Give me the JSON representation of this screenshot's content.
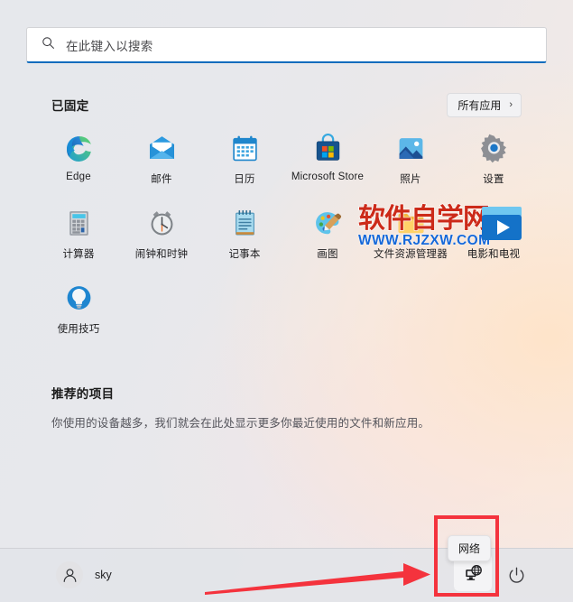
{
  "search": {
    "placeholder": "在此键入以搜索",
    "icon": "search-icon",
    "accent": "#0f6cbd"
  },
  "pinned": {
    "title": "已固定",
    "all_apps_label": "所有应用",
    "all_apps_chevron": "›",
    "rows": [
      [
        {
          "label": "Edge",
          "icon": "edge-icon"
        },
        {
          "label": "邮件",
          "icon": "mail-icon"
        },
        {
          "label": "日历",
          "icon": "calendar-icon"
        },
        {
          "label": "Microsoft Store",
          "icon": "microsoft-store-icon"
        },
        {
          "label": "照片",
          "icon": "photos-icon"
        },
        {
          "label": "设置",
          "icon": "settings-gear-icon"
        }
      ],
      [
        {
          "label": "计算器",
          "icon": "calculator-icon"
        },
        {
          "label": "闹钟和时钟",
          "icon": "alarm-clock-icon"
        },
        {
          "label": "记事本",
          "icon": "notepad-icon"
        },
        {
          "label": "画图",
          "icon": "paint-palette-icon"
        },
        {
          "label": "文件资源管理器",
          "icon": "file-explorer-icon"
        },
        {
          "label": "电影和电视",
          "icon": "movies-tv-icon"
        }
      ],
      [
        {
          "label": "使用技巧",
          "icon": "tips-lightbulb-icon"
        }
      ]
    ]
  },
  "recommended": {
    "title": "推荐的项目",
    "description": "你使用的设备越多，我们就会在此处显示更多你最近使用的文件和新应用。"
  },
  "bottom": {
    "user_name": "sky",
    "avatar_icon": "user-avatar-icon",
    "power_icon": "power-icon",
    "network": {
      "tooltip": "网络",
      "icon": "network-globe-icon"
    }
  },
  "annotations": {
    "highlight_color": "#f4333d",
    "arrow_color": "#f4333d"
  },
  "watermark": {
    "main": "软件自学网",
    "sub": "WWW.RJZXW.COM",
    "main_color": "#cc2a19",
    "sub_color": "#1668d8"
  }
}
